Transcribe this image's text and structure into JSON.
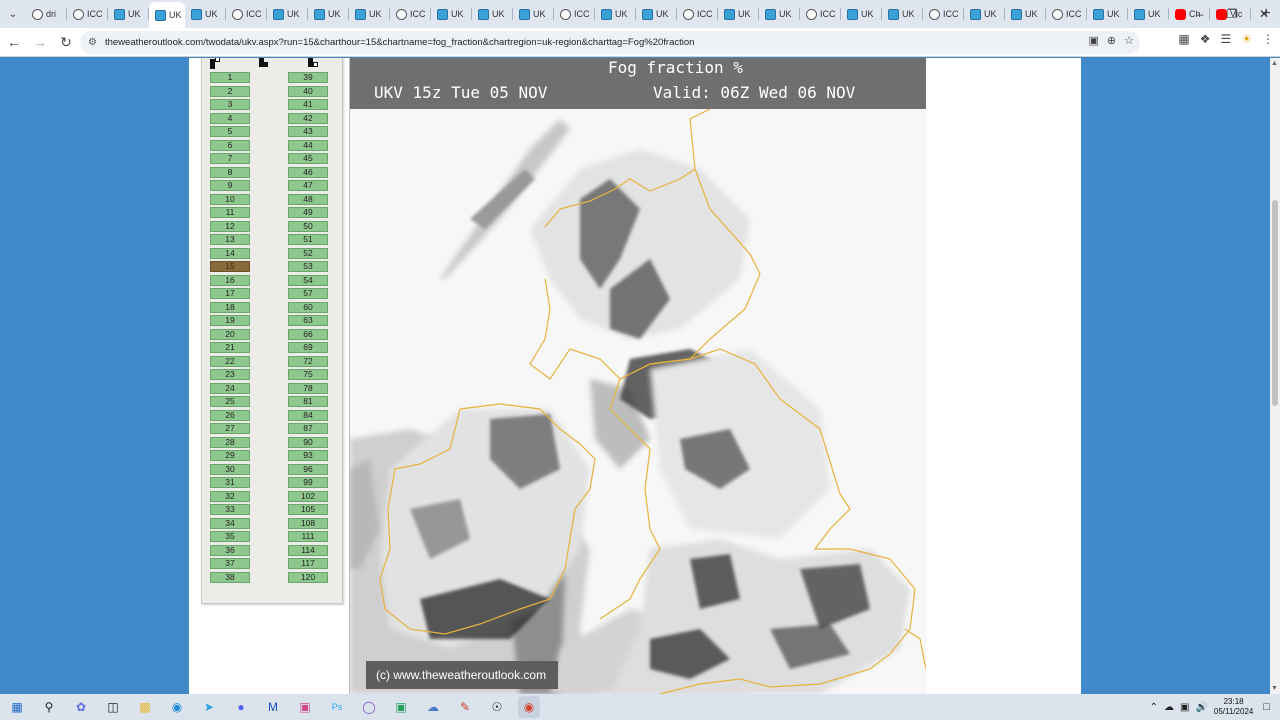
{
  "browser": {
    "tabs": [
      {
        "label": "dri",
        "icon": "drive-favicon",
        "active": false
      },
      {
        "label": "ICC",
        "icon": "icc-favicon",
        "active": false
      },
      {
        "label": "UK",
        "icon": "weather-favicon",
        "active": false
      },
      {
        "label": "UK",
        "icon": "weather-favicon",
        "active": true
      },
      {
        "label": "UK",
        "icon": "weather-favicon",
        "active": false
      },
      {
        "label": "ICC",
        "icon": "icc-favicon",
        "active": false
      },
      {
        "label": "UK",
        "icon": "weather-favicon",
        "active": false
      },
      {
        "label": "UK",
        "icon": "weather-favicon",
        "active": false
      },
      {
        "label": "UK",
        "icon": "weather-favicon",
        "active": false
      },
      {
        "label": "ICC",
        "icon": "icc-favicon",
        "active": false
      },
      {
        "label": "UK",
        "icon": "weather-favicon",
        "active": false
      },
      {
        "label": "UK",
        "icon": "weather-favicon",
        "active": false
      },
      {
        "label": "UK",
        "icon": "weather-favicon",
        "active": false
      },
      {
        "label": "ICC",
        "icon": "icc-favicon",
        "active": false
      },
      {
        "label": "UK",
        "icon": "weather-favicon",
        "active": false
      },
      {
        "label": "UK",
        "icon": "weather-favicon",
        "active": false
      },
      {
        "label": "ICC",
        "icon": "icc-favicon",
        "active": false
      },
      {
        "label": "UK",
        "icon": "weather-favicon",
        "active": false
      },
      {
        "label": "UK",
        "icon": "weather-favicon",
        "active": false
      },
      {
        "label": "ICC",
        "icon": "icc-favicon",
        "active": false
      },
      {
        "label": "UK",
        "icon": "weather-favicon",
        "active": false
      },
      {
        "label": "UK",
        "icon": "weather-favicon",
        "active": false
      },
      {
        "label": "ICC",
        "icon": "icc-favicon",
        "active": false
      },
      {
        "label": "UK",
        "icon": "weather-favicon",
        "active": false
      },
      {
        "label": "UK",
        "icon": "weather-favicon",
        "active": false
      },
      {
        "label": "ICC",
        "icon": "icc-favicon",
        "active": false
      },
      {
        "label": "UK",
        "icon": "weather-favicon",
        "active": false
      },
      {
        "label": "UK",
        "icon": "weather-favicon",
        "active": false
      },
      {
        "label": "Ch",
        "icon": "youtube-favicon",
        "active": false
      },
      {
        "label": "Vic",
        "icon": "youtube-favicon",
        "active": false
      }
    ],
    "url": "theweatheroutlook.com/twodata/ukv.aspx?run=15&charthour=15&chartname=fog_fraction&chartregion=uk-region&charttag=Fog%20fraction"
  },
  "chart_selector": {
    "left_column": [
      "1",
      "2",
      "3",
      "4",
      "5",
      "6",
      "7",
      "8",
      "9",
      "10",
      "11",
      "12",
      "13",
      "14",
      "15",
      "16",
      "17",
      "18",
      "19",
      "20",
      "21",
      "22",
      "23",
      "24",
      "25",
      "26",
      "27",
      "28",
      "29",
      "30",
      "31",
      "32",
      "33",
      "34",
      "35",
      "36",
      "37",
      "38"
    ],
    "right_column": [
      "39",
      "40",
      "41",
      "42",
      "43",
      "44",
      "45",
      "46",
      "47",
      "48",
      "49",
      "50",
      "51",
      "52",
      "53",
      "54",
      "57",
      "60",
      "63",
      "66",
      "69",
      "72",
      "75",
      "78",
      "81",
      "84",
      "87",
      "90",
      "93",
      "96",
      "99",
      "102",
      "105",
      "108",
      "111",
      "114",
      "117",
      "120"
    ],
    "selected": "15"
  },
  "map": {
    "title": "Fog fraction %",
    "run_label": "UKV 15z Tue 05 NOV",
    "valid_label": "Valid: 06Z Wed 06 NOV",
    "copyright": "(c) www.theweatheroutlook.com"
  },
  "taskbar": {
    "time": "23:18",
    "date": "05/11/2024"
  }
}
